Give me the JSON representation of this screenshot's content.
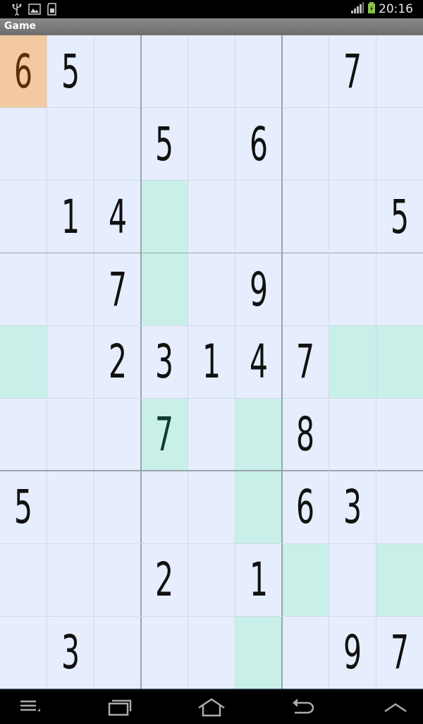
{
  "status": {
    "time": "20:16",
    "icons": [
      "usb-icon",
      "gallery-icon",
      "sd-card-icon"
    ]
  },
  "title": "Game",
  "board": {
    "cells": [
      [
        "6",
        "5",
        "",
        "",
        "",
        "",
        "",
        "7",
        ""
      ],
      [
        "",
        "",
        "",
        "5",
        "",
        "6",
        "",
        "",
        ""
      ],
      [
        "",
        "1",
        "4",
        "",
        "",
        "",
        "",
        "",
        "5"
      ],
      [
        "",
        "",
        "7",
        "",
        "",
        "9",
        "",
        "",
        ""
      ],
      [
        "",
        "",
        "2",
        "3",
        "1",
        "4",
        "7",
        "",
        ""
      ],
      [
        "",
        "",
        "",
        "7",
        "",
        "",
        "8",
        "",
        ""
      ],
      [
        "5",
        "",
        "",
        "",
        "",
        "",
        "6",
        "3",
        ""
      ],
      [
        "",
        "",
        "",
        "2",
        "",
        "1",
        "",
        "",
        ""
      ],
      [
        "",
        "3",
        "",
        "",
        "",
        "",
        "",
        "9",
        "7"
      ]
    ],
    "highlighted": [
      [
        2,
        3
      ],
      [
        3,
        3
      ],
      [
        4,
        0
      ],
      [
        4,
        7
      ],
      [
        4,
        8
      ],
      [
        5,
        3
      ],
      [
        5,
        5
      ],
      [
        6,
        5
      ],
      [
        7,
        6
      ],
      [
        7,
        8
      ],
      [
        8,
        5
      ]
    ],
    "selected": [
      0,
      0
    ],
    "colors": {
      "background": "#e6eefd",
      "highlight": "#c8f0e8",
      "selected": "#f2c9a0",
      "selected_text": "#5a2e0a",
      "highlight_text": "#0f3a2a",
      "thin_line": "#cfd9ea",
      "thick_line": "#9aa3ad"
    }
  },
  "nav": [
    "menu-icon",
    "recent-apps-icon",
    "home-icon",
    "back-icon",
    "up-icon"
  ]
}
